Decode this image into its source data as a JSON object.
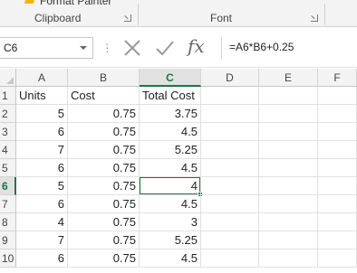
{
  "ribbon": {
    "format_painter": "Format Painter",
    "clipboard_label": "Clipboard",
    "font_label": "Font"
  },
  "formula_bar": {
    "name_box": "C6",
    "formula": "=A6*B6+0.25"
  },
  "sheet": {
    "columns": [
      "A",
      "B",
      "C",
      "D",
      "E",
      "F"
    ],
    "rows": [
      {
        "num": "1",
        "cells": [
          "Units",
          "Cost",
          "Total Cost",
          "",
          "",
          ""
        ]
      },
      {
        "num": "2",
        "cells": [
          "5",
          "0.75",
          "3.75",
          "",
          "",
          ""
        ]
      },
      {
        "num": "3",
        "cells": [
          "6",
          "0.75",
          "4.5",
          "",
          "",
          ""
        ]
      },
      {
        "num": "4",
        "cells": [
          "7",
          "0.75",
          "5.25",
          "",
          "",
          ""
        ]
      },
      {
        "num": "5",
        "cells": [
          "6",
          "0.75",
          "4.5",
          "",
          "",
          ""
        ]
      },
      {
        "num": "6",
        "cells": [
          "5",
          "0.75",
          "4",
          "",
          "",
          ""
        ]
      },
      {
        "num": "7",
        "cells": [
          "6",
          "0.75",
          "4.5",
          "",
          "",
          ""
        ]
      },
      {
        "num": "8",
        "cells": [
          "4",
          "0.75",
          "3",
          "",
          "",
          ""
        ]
      },
      {
        "num": "9",
        "cells": [
          "7",
          "0.75",
          "5.25",
          "",
          "",
          ""
        ]
      },
      {
        "num": "10",
        "cells": [
          "6",
          "0.75",
          "4.5",
          "",
          "",
          ""
        ]
      }
    ],
    "active_column": "C",
    "active_row": "6"
  },
  "colors": {
    "accent": "#217346"
  },
  "icons": {
    "cancel": "close-icon",
    "enter": "check-icon",
    "insert_function": "fx-icon",
    "dropdown": "chevron-down-icon"
  }
}
